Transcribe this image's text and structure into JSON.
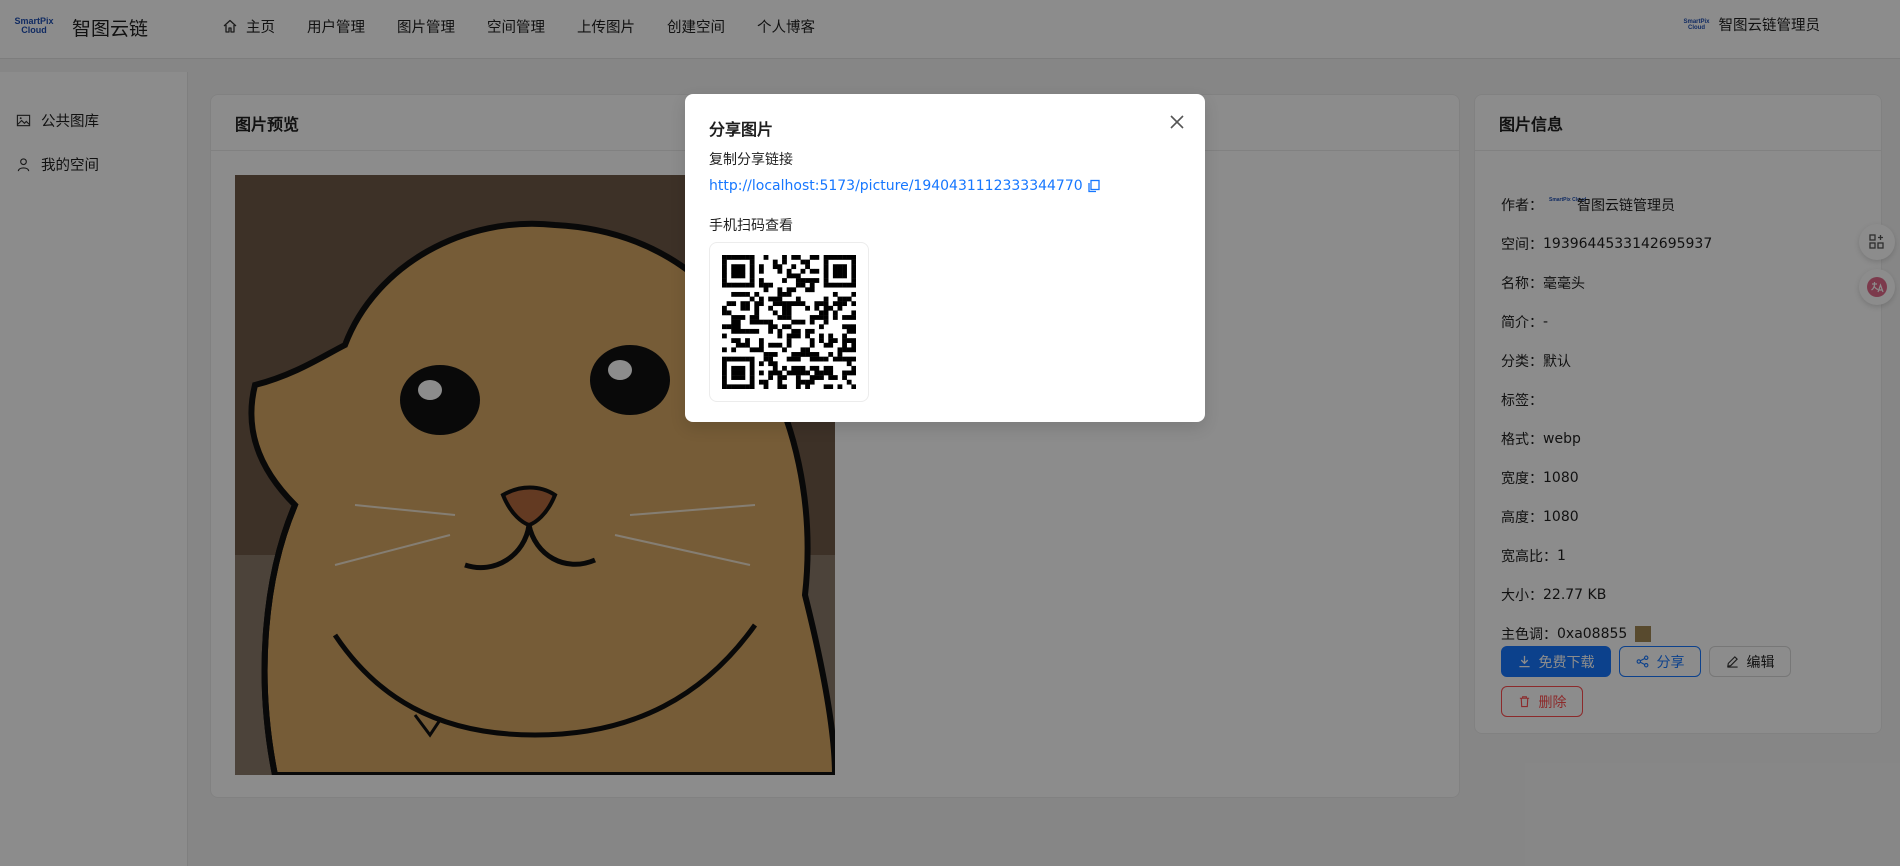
{
  "header": {
    "logo_text": "SmartPix Cloud",
    "app_title": "智图云链",
    "nav": [
      {
        "label": "主页",
        "icon": "home-icon"
      },
      {
        "label": "用户管理"
      },
      {
        "label": "图片管理"
      },
      {
        "label": "空间管理"
      },
      {
        "label": "上传图片"
      },
      {
        "label": "创建空间"
      },
      {
        "label": "个人博客"
      }
    ],
    "user_name": "智图云链管理员"
  },
  "sidebar": {
    "items": [
      {
        "label": "公共图库",
        "icon": "picture-icon"
      },
      {
        "label": "我的空间",
        "icon": "user-icon"
      }
    ]
  },
  "preview": {
    "title": "图片预览"
  },
  "info": {
    "title": "图片信息",
    "rows": [
      {
        "key": "作者：",
        "value": "智图云链管理员"
      },
      {
        "key": "空间：",
        "value": "1939644533142695937"
      },
      {
        "key": "名称：",
        "value": "毫毫头"
      },
      {
        "key": "简介：",
        "value": "-"
      },
      {
        "key": "分类：",
        "value": "默认"
      },
      {
        "key": "标签：",
        "value": ""
      },
      {
        "key": "格式：",
        "value": "webp"
      },
      {
        "key": "宽度：",
        "value": "1080"
      },
      {
        "key": "高度：",
        "value": "1080"
      },
      {
        "key": "宽高比：",
        "value": "1"
      },
      {
        "key": "大小：",
        "value": "22.77 KB"
      },
      {
        "key": "主色调：",
        "value": "0xa08855"
      }
    ],
    "dominant_color": "#a08855",
    "buttons": {
      "download": "免费下载",
      "share": "分享",
      "edit": "编辑",
      "delete": "删除"
    }
  },
  "modal": {
    "title": "分享图片",
    "copy_label": "复制分享链接",
    "link": "http://localhost:5173/picture/1940431112333344770",
    "scan_label": "手机扫码查看"
  },
  "colors": {
    "primary": "#1677ff",
    "danger": "#ff4d4f",
    "mask": "rgba(0,0,0,0.45)"
  }
}
